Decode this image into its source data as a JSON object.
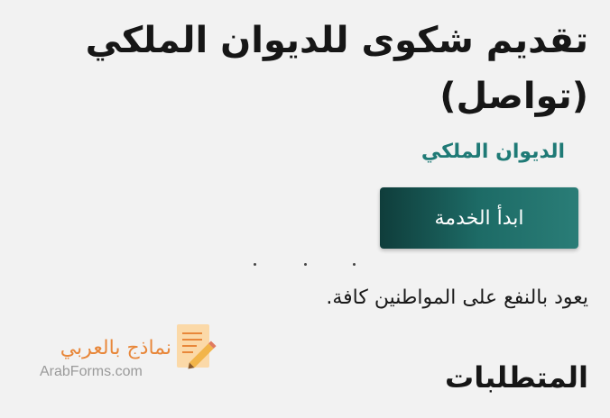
{
  "service": {
    "title": "تقديم شكوى للديوان الملكي (تواصل)",
    "provider": "الديوان الملكي",
    "start_button_label": "ابدأ الخدمة",
    "description": "يعود بالنفع على المواطنين كافة.",
    "requirements_heading": "المتطلبات"
  },
  "watermark": {
    "arabic_text": "نماذج بالعربي",
    "english_text": "ArabForms.com",
    "icon": "document-pencil-icon",
    "accent_color": "#e8873a"
  },
  "colors": {
    "button_dark": "#0f3d3b",
    "button_light": "#2a7d77",
    "provider_text": "#1f7a76",
    "background": "#f2f2f2"
  }
}
